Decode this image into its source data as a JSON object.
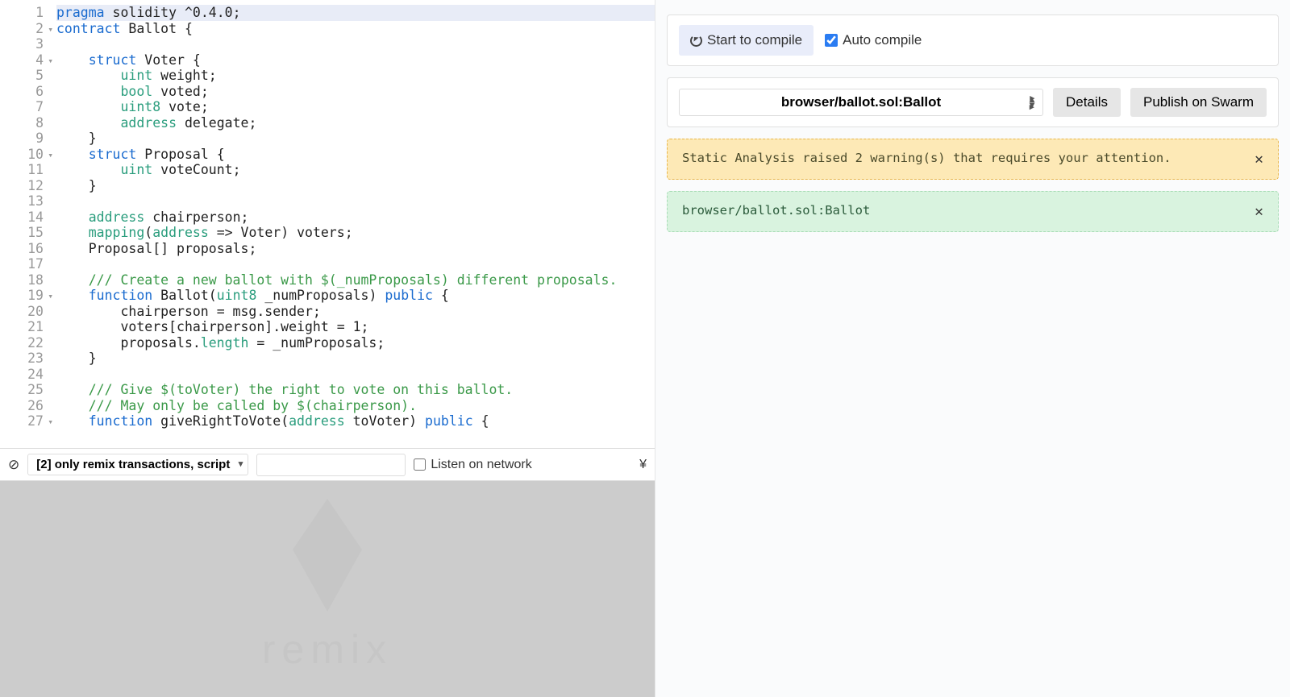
{
  "editor": {
    "fold_lines": [
      2,
      4,
      10,
      19,
      27
    ],
    "lines": [
      {
        "n": 1,
        "hl": true,
        "t": [
          {
            "c": "k",
            "s": "pragma"
          },
          {
            "c": "n",
            "s": " solidity "
          },
          {
            "c": "p",
            "s": "^"
          },
          {
            "c": "n",
            "s": "0.4.0"
          },
          {
            "c": "p",
            "s": ";"
          }
        ]
      },
      {
        "n": 2,
        "t": [
          {
            "c": "k",
            "s": "contract"
          },
          {
            "c": "n",
            "s": " Ballot "
          },
          {
            "c": "p",
            "s": "{"
          }
        ]
      },
      {
        "n": 3,
        "t": [
          {
            "c": "n",
            "s": ""
          }
        ]
      },
      {
        "n": 4,
        "t": [
          {
            "c": "n",
            "s": "    "
          },
          {
            "c": "k",
            "s": "struct"
          },
          {
            "c": "n",
            "s": " Voter "
          },
          {
            "c": "p",
            "s": "{"
          }
        ]
      },
      {
        "n": 5,
        "t": [
          {
            "c": "n",
            "s": "        "
          },
          {
            "c": "t",
            "s": "uint"
          },
          {
            "c": "n",
            "s": " weight"
          },
          {
            "c": "p",
            "s": ";"
          }
        ]
      },
      {
        "n": 6,
        "t": [
          {
            "c": "n",
            "s": "        "
          },
          {
            "c": "t",
            "s": "bool"
          },
          {
            "c": "n",
            "s": " voted"
          },
          {
            "c": "p",
            "s": ";"
          }
        ]
      },
      {
        "n": 7,
        "t": [
          {
            "c": "n",
            "s": "        "
          },
          {
            "c": "t",
            "s": "uint8"
          },
          {
            "c": "n",
            "s": " vote"
          },
          {
            "c": "p",
            "s": ";"
          }
        ]
      },
      {
        "n": 8,
        "t": [
          {
            "c": "n",
            "s": "        "
          },
          {
            "c": "t",
            "s": "address"
          },
          {
            "c": "n",
            "s": " delegate"
          },
          {
            "c": "p",
            "s": ";"
          }
        ]
      },
      {
        "n": 9,
        "t": [
          {
            "c": "n",
            "s": "    "
          },
          {
            "c": "p",
            "s": "}"
          }
        ]
      },
      {
        "n": 10,
        "t": [
          {
            "c": "n",
            "s": "    "
          },
          {
            "c": "k",
            "s": "struct"
          },
          {
            "c": "n",
            "s": " Proposal "
          },
          {
            "c": "p",
            "s": "{"
          }
        ]
      },
      {
        "n": 11,
        "t": [
          {
            "c": "n",
            "s": "        "
          },
          {
            "c": "t",
            "s": "uint"
          },
          {
            "c": "n",
            "s": " voteCount"
          },
          {
            "c": "p",
            "s": ";"
          }
        ]
      },
      {
        "n": 12,
        "t": [
          {
            "c": "n",
            "s": "    "
          },
          {
            "c": "p",
            "s": "}"
          }
        ]
      },
      {
        "n": 13,
        "t": [
          {
            "c": "n",
            "s": ""
          }
        ]
      },
      {
        "n": 14,
        "t": [
          {
            "c": "n",
            "s": "    "
          },
          {
            "c": "t",
            "s": "address"
          },
          {
            "c": "n",
            "s": " chairperson"
          },
          {
            "c": "p",
            "s": ";"
          }
        ]
      },
      {
        "n": 15,
        "t": [
          {
            "c": "n",
            "s": "    "
          },
          {
            "c": "t",
            "s": "mapping"
          },
          {
            "c": "p",
            "s": "("
          },
          {
            "c": "t",
            "s": "address"
          },
          {
            "c": "n",
            "s": " "
          },
          {
            "c": "p",
            "s": "=>"
          },
          {
            "c": "n",
            "s": " Voter"
          },
          {
            "c": "p",
            "s": ")"
          },
          {
            "c": "n",
            "s": " voters"
          },
          {
            "c": "p",
            "s": ";"
          }
        ]
      },
      {
        "n": 16,
        "t": [
          {
            "c": "n",
            "s": "    Proposal"
          },
          {
            "c": "p",
            "s": "[]"
          },
          {
            "c": "n",
            "s": " proposals"
          },
          {
            "c": "p",
            "s": ";"
          }
        ]
      },
      {
        "n": 17,
        "t": [
          {
            "c": "n",
            "s": ""
          }
        ]
      },
      {
        "n": 18,
        "t": [
          {
            "c": "n",
            "s": "    "
          },
          {
            "c": "c",
            "s": "/// Create a new ballot with $(_numProposals) different proposals."
          }
        ]
      },
      {
        "n": 19,
        "t": [
          {
            "c": "n",
            "s": "    "
          },
          {
            "c": "k",
            "s": "function"
          },
          {
            "c": "n",
            "s": " Ballot"
          },
          {
            "c": "p",
            "s": "("
          },
          {
            "c": "t",
            "s": "uint8"
          },
          {
            "c": "n",
            "s": " _numProposals"
          },
          {
            "c": "p",
            "s": ")"
          },
          {
            "c": "n",
            "s": " "
          },
          {
            "c": "k",
            "s": "public"
          },
          {
            "c": "n",
            "s": " "
          },
          {
            "c": "p",
            "s": "{"
          }
        ]
      },
      {
        "n": 20,
        "t": [
          {
            "c": "n",
            "s": "        chairperson "
          },
          {
            "c": "p",
            "s": "="
          },
          {
            "c": "n",
            "s": " msg.sender"
          },
          {
            "c": "p",
            "s": ";"
          }
        ]
      },
      {
        "n": 21,
        "t": [
          {
            "c": "n",
            "s": "        voters"
          },
          {
            "c": "p",
            "s": "["
          },
          {
            "c": "n",
            "s": "chairperson"
          },
          {
            "c": "p",
            "s": "]."
          },
          {
            "c": "n",
            "s": "weight "
          },
          {
            "c": "p",
            "s": "="
          },
          {
            "c": "n",
            "s": " 1"
          },
          {
            "c": "p",
            "s": ";"
          }
        ]
      },
      {
        "n": 22,
        "t": [
          {
            "c": "n",
            "s": "        proposals."
          },
          {
            "c": "t",
            "s": "length"
          },
          {
            "c": "n",
            "s": " "
          },
          {
            "c": "p",
            "s": "="
          },
          {
            "c": "n",
            "s": " _numProposals"
          },
          {
            "c": "p",
            "s": ";"
          }
        ]
      },
      {
        "n": 23,
        "t": [
          {
            "c": "n",
            "s": "    "
          },
          {
            "c": "p",
            "s": "}"
          }
        ]
      },
      {
        "n": 24,
        "t": [
          {
            "c": "n",
            "s": ""
          }
        ]
      },
      {
        "n": 25,
        "t": [
          {
            "c": "n",
            "s": "    "
          },
          {
            "c": "c",
            "s": "/// Give $(toVoter) the right to vote on this ballot."
          }
        ]
      },
      {
        "n": 26,
        "t": [
          {
            "c": "n",
            "s": "    "
          },
          {
            "c": "c",
            "s": "/// May only be called by $(chairperson)."
          }
        ]
      },
      {
        "n": 27,
        "t": [
          {
            "c": "n",
            "s": "    "
          },
          {
            "c": "k",
            "s": "function"
          },
          {
            "c": "n",
            "s": " giveRightToVote"
          },
          {
            "c": "p",
            "s": "("
          },
          {
            "c": "t",
            "s": "address"
          },
          {
            "c": "n",
            "s": " toVoter"
          },
          {
            "c": "p",
            "s": ")"
          },
          {
            "c": "n",
            "s": " "
          },
          {
            "c": "k",
            "s": "public"
          },
          {
            "c": "n",
            "s": " "
          },
          {
            "c": "p",
            "s": "{"
          }
        ]
      }
    ]
  },
  "terminal": {
    "filter_label": "[2] only remix transactions, script",
    "listen_label": "Listen on network",
    "watermark": "remix"
  },
  "right": {
    "compile_btn": "Start to compile",
    "auto_compile": "Auto compile",
    "contract_selected": "browser/ballot.sol:Ballot",
    "details_btn": "Details",
    "swarm_btn": "Publish on Swarm",
    "warn_text": "Static Analysis raised 2 warning(s) that requires your attention.",
    "ok_text": "browser/ballot.sol:Ballot"
  }
}
